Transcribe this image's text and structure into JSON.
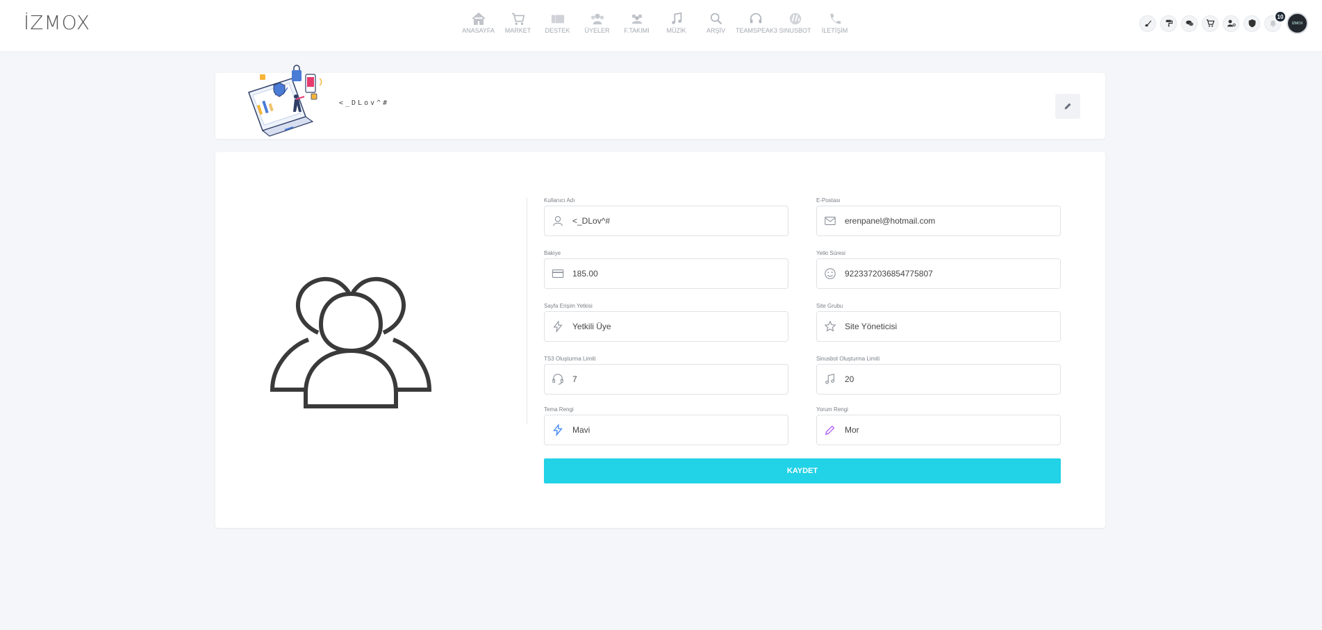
{
  "brand": {
    "logo": "İZMOX"
  },
  "nav": [
    {
      "label": "ANASAYFA",
      "icon": "home-icon"
    },
    {
      "label": "MARKET",
      "icon": "cart-icon"
    },
    {
      "label": "DESTEK",
      "icon": "ticket-icon"
    },
    {
      "label": "ÜYELER",
      "icon": "users-icon"
    },
    {
      "label": "F.TAKIMI",
      "icon": "team-icon"
    },
    {
      "label": "MÜZİK",
      "icon": "music-icon"
    },
    {
      "label": "ARŞİV",
      "icon": "search-icon"
    },
    {
      "label": "TEAMSPEAK3",
      "icon": "headset-icon"
    },
    {
      "label": "SINUSBOT",
      "icon": "sinusbot-icon"
    },
    {
      "label": "İLETİŞİM",
      "icon": "phone-icon"
    }
  ],
  "header_right": {
    "notification_count": "10",
    "avatar_text": "İZMOX"
  },
  "profile": {
    "name": "<_DLov^#"
  },
  "form": {
    "username": {
      "label": "Kullanıcı Adı",
      "value": "<_DLov^#"
    },
    "email": {
      "label": "E-Postası",
      "value": "erenpanel@hotmail.com"
    },
    "balance": {
      "label": "Bakiye",
      "value": "185.00"
    },
    "auth_duration": {
      "label": "Yetki Süresi",
      "value": "9223372036854775807"
    },
    "page_access": {
      "label": "Sayfa Erişim Yetkisi",
      "value": "Yetkili Üye"
    },
    "site_group": {
      "label": "Site Grubu",
      "value": "Site Yöneticisi"
    },
    "ts3_limit": {
      "label": "TS3 Oluşturma Limiti",
      "value": "7"
    },
    "sinusbot_limit": {
      "label": "Sinusbot Oluşturma Limiti",
      "value": "20"
    },
    "theme_color": {
      "label": "Tema Rengi",
      "value": "Mavi"
    },
    "comment_color": {
      "label": "Yorum Rengi",
      "value": "Mor"
    },
    "save_label": "KAYDET"
  },
  "colors": {
    "accent": "#22d2e6",
    "theme_icon": "#3b82f6",
    "comment_icon": "#a855f7"
  }
}
